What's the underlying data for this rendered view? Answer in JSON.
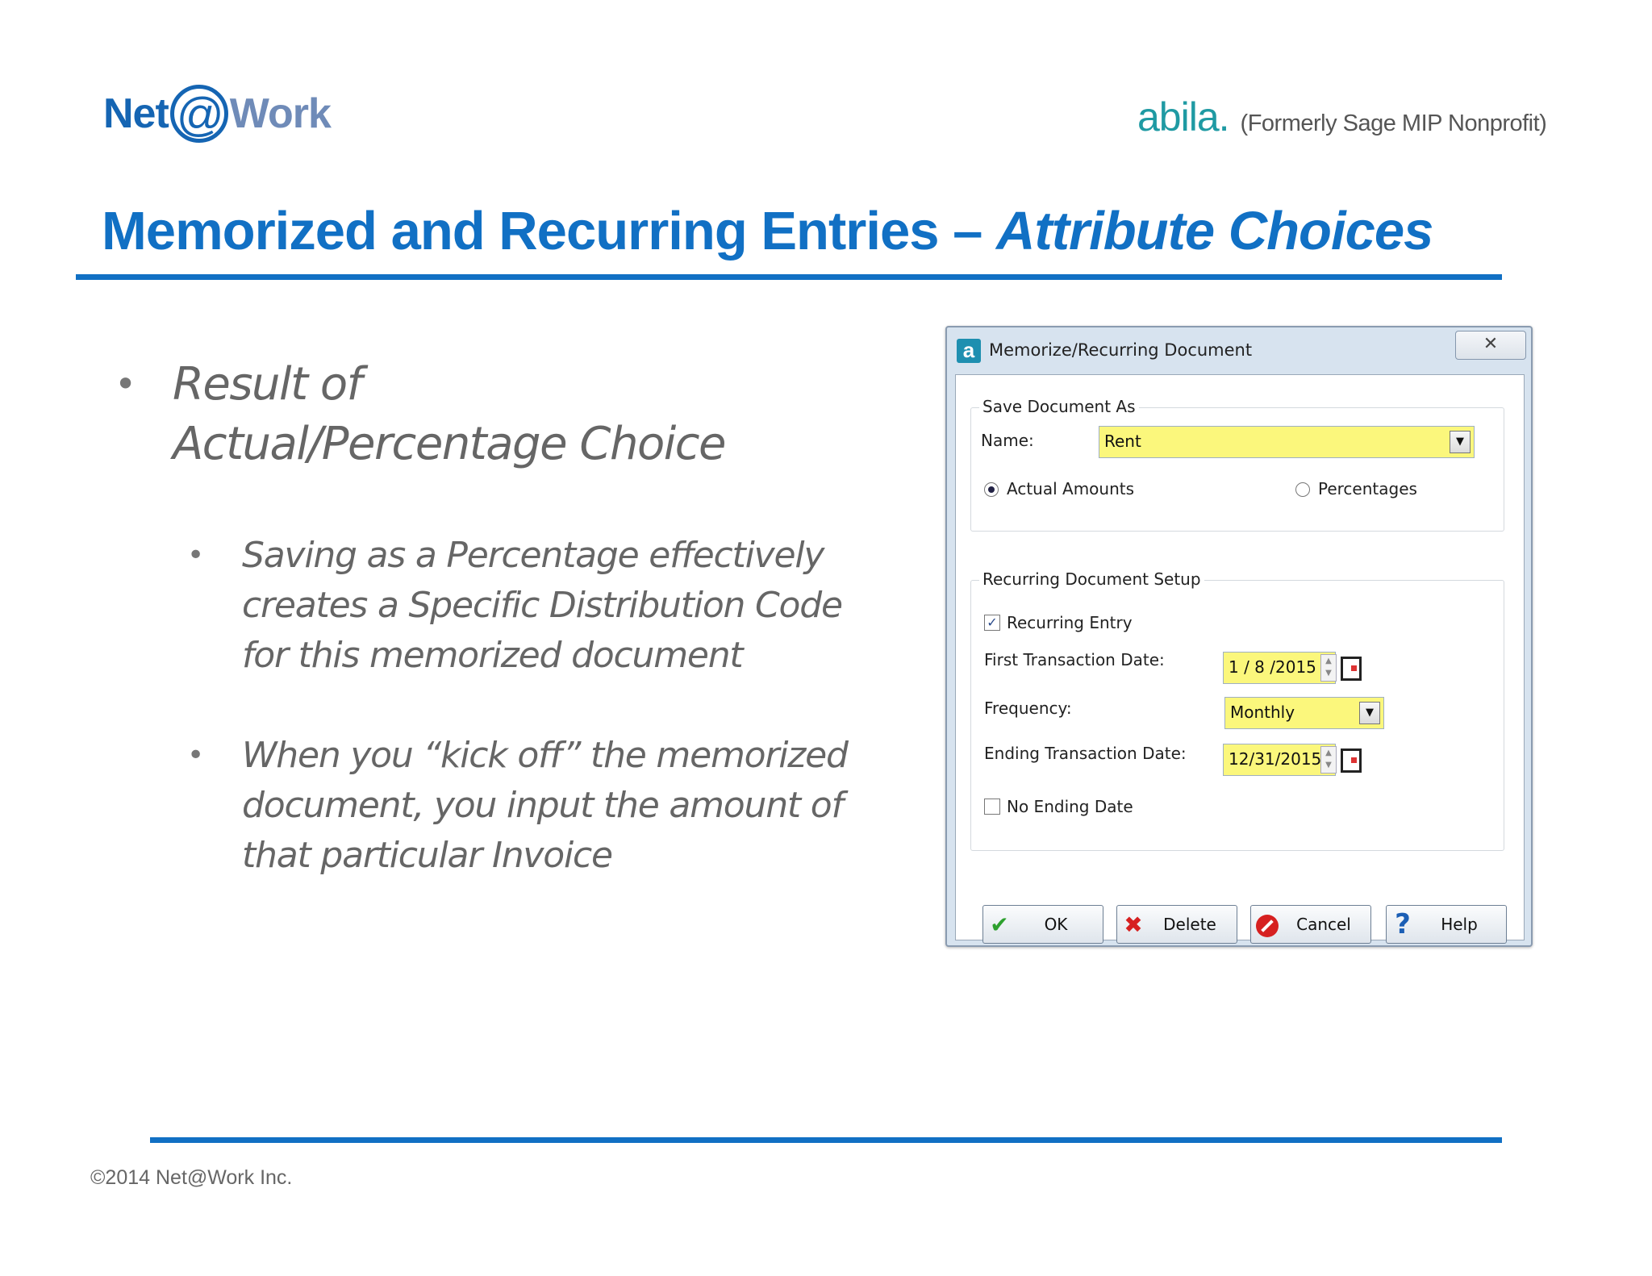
{
  "header": {
    "networks_logo": {
      "left": "Net",
      "at": "@",
      "right": "Work"
    },
    "abila_logo": {
      "brand": "abila.",
      "subtitle": "(Formerly Sage MIP Nonprofit)"
    }
  },
  "slide": {
    "title_main": "Memorized and Recurring Entries – ",
    "title_emphasis": "Attribute Choices",
    "bullet_main": "Result of Actual/Percentage Choice",
    "bullet_sub_1": "Saving as a Percentage effectively creates a Specific Distribution Code for this memorized document",
    "bullet_sub_2": "When you “kick off” the memorized document, you input the amount of that particular Invoice",
    "bullet_glyph": "•"
  },
  "footer": {
    "copyright": "©2014 Net@Work Inc."
  },
  "dialog": {
    "title": "Memorize/Recurring Document",
    "app_icon": "a",
    "close_glyph": "✕",
    "save_group_label": "Save Document As",
    "name_label": "Name:",
    "name_value": "Rent",
    "radio_actual": "Actual Amounts",
    "radio_percentages": "Percentages",
    "selected_radio": "Actual Amounts",
    "recurring_group_label": "Recurring Document Setup",
    "recurring_entry_label": "Recurring Entry",
    "recurring_entry_checked": true,
    "first_date_label": "First Transaction Date:",
    "first_date_value": "1 / 8 /2015",
    "frequency_label": "Frequency:",
    "frequency_value": "Monthly",
    "ending_date_label": "Ending Transaction Date:",
    "ending_date_value": "12/31/2015",
    "no_ending_label": "No Ending Date",
    "no_ending_checked": false,
    "buttons": {
      "ok": "OK",
      "delete": "Delete",
      "cancel": "Cancel",
      "help": "Help"
    },
    "icons": {
      "ok": "checkmark-icon",
      "delete": "x-icon",
      "cancel": "no-entry-icon",
      "help": "question-icon"
    },
    "colors": {
      "field_highlight": "#fbf77c",
      "accent_blue": "#1170c4"
    }
  }
}
